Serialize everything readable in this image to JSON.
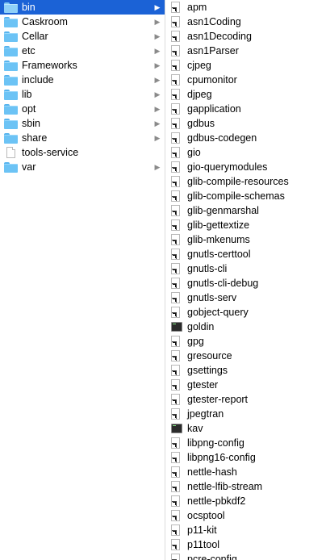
{
  "column1": {
    "items": [
      {
        "label": "bin",
        "type": "folder",
        "selected": true,
        "icon": "folder-icon"
      },
      {
        "label": "Caskroom",
        "type": "folder",
        "icon": "folder-icon"
      },
      {
        "label": "Cellar",
        "type": "folder",
        "icon": "folder-icon"
      },
      {
        "label": "etc",
        "type": "folder",
        "icon": "folder-icon"
      },
      {
        "label": "Frameworks",
        "type": "folder",
        "icon": "folder-icon"
      },
      {
        "label": "include",
        "type": "folder",
        "icon": "folder-icon"
      },
      {
        "label": "lib",
        "type": "folder",
        "icon": "folder-icon"
      },
      {
        "label": "opt",
        "type": "folder",
        "icon": "folder-icon"
      },
      {
        "label": "sbin",
        "type": "folder",
        "icon": "folder-icon"
      },
      {
        "label": "share",
        "type": "folder",
        "icon": "folder-icon"
      },
      {
        "label": "tools-service",
        "type": "file",
        "icon": "document-icon"
      },
      {
        "label": "var",
        "type": "folder",
        "icon": "folder-icon"
      }
    ]
  },
  "column2": {
    "items": [
      {
        "label": "apm",
        "type": "alias"
      },
      {
        "label": "asn1Coding",
        "type": "alias"
      },
      {
        "label": "asn1Decoding",
        "type": "alias"
      },
      {
        "label": "asn1Parser",
        "type": "alias"
      },
      {
        "label": "cjpeg",
        "type": "alias"
      },
      {
        "label": "cpumonitor",
        "type": "alias"
      },
      {
        "label": "djpeg",
        "type": "alias"
      },
      {
        "label": "gapplication",
        "type": "alias"
      },
      {
        "label": "gdbus",
        "type": "alias"
      },
      {
        "label": "gdbus-codegen",
        "type": "alias"
      },
      {
        "label": "gio",
        "type": "alias"
      },
      {
        "label": "gio-querymodules",
        "type": "alias"
      },
      {
        "label": "glib-compile-resources",
        "type": "alias"
      },
      {
        "label": "glib-compile-schemas",
        "type": "alias"
      },
      {
        "label": "glib-genmarshal",
        "type": "alias"
      },
      {
        "label": "glib-gettextize",
        "type": "alias"
      },
      {
        "label": "glib-mkenums",
        "type": "alias"
      },
      {
        "label": "gnutls-certtool",
        "type": "alias"
      },
      {
        "label": "gnutls-cli",
        "type": "alias"
      },
      {
        "label": "gnutls-cli-debug",
        "type": "alias"
      },
      {
        "label": "gnutls-serv",
        "type": "alias"
      },
      {
        "label": "gobject-query",
        "type": "alias"
      },
      {
        "label": "goldin",
        "type": "exec"
      },
      {
        "label": "gpg",
        "type": "alias"
      },
      {
        "label": "gresource",
        "type": "alias"
      },
      {
        "label": "gsettings",
        "type": "alias"
      },
      {
        "label": "gtester",
        "type": "alias"
      },
      {
        "label": "gtester-report",
        "type": "alias"
      },
      {
        "label": "jpegtran",
        "type": "alias"
      },
      {
        "label": "kav",
        "type": "exec"
      },
      {
        "label": "libpng-config",
        "type": "alias"
      },
      {
        "label": "libpng16-config",
        "type": "alias"
      },
      {
        "label": "nettle-hash",
        "type": "alias"
      },
      {
        "label": "nettle-lfib-stream",
        "type": "alias"
      },
      {
        "label": "nettle-pbkdf2",
        "type": "alias"
      },
      {
        "label": "ocsptool",
        "type": "alias"
      },
      {
        "label": "p11-kit",
        "type": "alias"
      },
      {
        "label": "p11tool",
        "type": "alias"
      },
      {
        "label": "pcre-config",
        "type": "alias"
      }
    ]
  },
  "chevron_glyph": "▶",
  "colors": {
    "selection": "#1b62d6",
    "folder": "#6cc3f5"
  }
}
